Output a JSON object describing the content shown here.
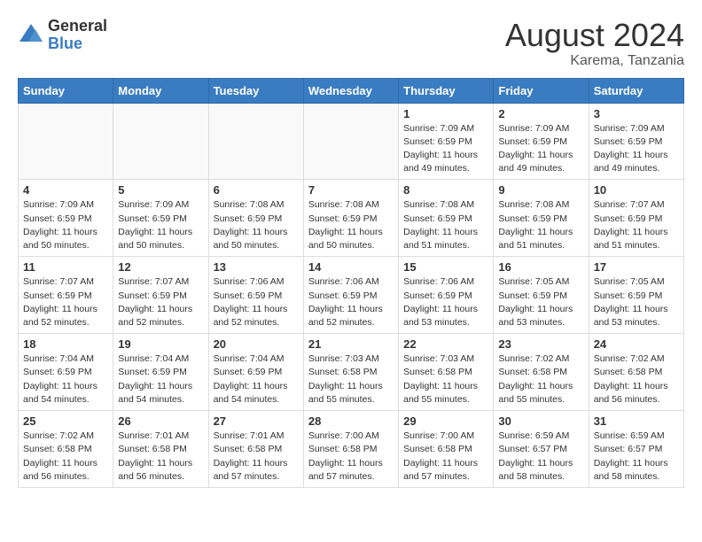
{
  "header": {
    "logo_general": "General",
    "logo_blue": "Blue",
    "month": "August 2024",
    "location": "Karema, Tanzania"
  },
  "weekdays": [
    "Sunday",
    "Monday",
    "Tuesday",
    "Wednesday",
    "Thursday",
    "Friday",
    "Saturday"
  ],
  "weeks": [
    [
      {
        "day": "",
        "info": ""
      },
      {
        "day": "",
        "info": ""
      },
      {
        "day": "",
        "info": ""
      },
      {
        "day": "",
        "info": ""
      },
      {
        "day": "1",
        "info": "Sunrise: 7:09 AM\nSunset: 6:59 PM\nDaylight: 11 hours\nand 49 minutes."
      },
      {
        "day": "2",
        "info": "Sunrise: 7:09 AM\nSunset: 6:59 PM\nDaylight: 11 hours\nand 49 minutes."
      },
      {
        "day": "3",
        "info": "Sunrise: 7:09 AM\nSunset: 6:59 PM\nDaylight: 11 hours\nand 49 minutes."
      }
    ],
    [
      {
        "day": "4",
        "info": "Sunrise: 7:09 AM\nSunset: 6:59 PM\nDaylight: 11 hours\nand 50 minutes."
      },
      {
        "day": "5",
        "info": "Sunrise: 7:09 AM\nSunset: 6:59 PM\nDaylight: 11 hours\nand 50 minutes."
      },
      {
        "day": "6",
        "info": "Sunrise: 7:08 AM\nSunset: 6:59 PM\nDaylight: 11 hours\nand 50 minutes."
      },
      {
        "day": "7",
        "info": "Sunrise: 7:08 AM\nSunset: 6:59 PM\nDaylight: 11 hours\nand 50 minutes."
      },
      {
        "day": "8",
        "info": "Sunrise: 7:08 AM\nSunset: 6:59 PM\nDaylight: 11 hours\nand 51 minutes."
      },
      {
        "day": "9",
        "info": "Sunrise: 7:08 AM\nSunset: 6:59 PM\nDaylight: 11 hours\nand 51 minutes."
      },
      {
        "day": "10",
        "info": "Sunrise: 7:07 AM\nSunset: 6:59 PM\nDaylight: 11 hours\nand 51 minutes."
      }
    ],
    [
      {
        "day": "11",
        "info": "Sunrise: 7:07 AM\nSunset: 6:59 PM\nDaylight: 11 hours\nand 52 minutes."
      },
      {
        "day": "12",
        "info": "Sunrise: 7:07 AM\nSunset: 6:59 PM\nDaylight: 11 hours\nand 52 minutes."
      },
      {
        "day": "13",
        "info": "Sunrise: 7:06 AM\nSunset: 6:59 PM\nDaylight: 11 hours\nand 52 minutes."
      },
      {
        "day": "14",
        "info": "Sunrise: 7:06 AM\nSunset: 6:59 PM\nDaylight: 11 hours\nand 52 minutes."
      },
      {
        "day": "15",
        "info": "Sunrise: 7:06 AM\nSunset: 6:59 PM\nDaylight: 11 hours\nand 53 minutes."
      },
      {
        "day": "16",
        "info": "Sunrise: 7:05 AM\nSunset: 6:59 PM\nDaylight: 11 hours\nand 53 minutes."
      },
      {
        "day": "17",
        "info": "Sunrise: 7:05 AM\nSunset: 6:59 PM\nDaylight: 11 hours\nand 53 minutes."
      }
    ],
    [
      {
        "day": "18",
        "info": "Sunrise: 7:04 AM\nSunset: 6:59 PM\nDaylight: 11 hours\nand 54 minutes."
      },
      {
        "day": "19",
        "info": "Sunrise: 7:04 AM\nSunset: 6:59 PM\nDaylight: 11 hours\nand 54 minutes."
      },
      {
        "day": "20",
        "info": "Sunrise: 7:04 AM\nSunset: 6:59 PM\nDaylight: 11 hours\nand 54 minutes."
      },
      {
        "day": "21",
        "info": "Sunrise: 7:03 AM\nSunset: 6:58 PM\nDaylight: 11 hours\nand 55 minutes."
      },
      {
        "day": "22",
        "info": "Sunrise: 7:03 AM\nSunset: 6:58 PM\nDaylight: 11 hours\nand 55 minutes."
      },
      {
        "day": "23",
        "info": "Sunrise: 7:02 AM\nSunset: 6:58 PM\nDaylight: 11 hours\nand 55 minutes."
      },
      {
        "day": "24",
        "info": "Sunrise: 7:02 AM\nSunset: 6:58 PM\nDaylight: 11 hours\nand 56 minutes."
      }
    ],
    [
      {
        "day": "25",
        "info": "Sunrise: 7:02 AM\nSunset: 6:58 PM\nDaylight: 11 hours\nand 56 minutes."
      },
      {
        "day": "26",
        "info": "Sunrise: 7:01 AM\nSunset: 6:58 PM\nDaylight: 11 hours\nand 56 minutes."
      },
      {
        "day": "27",
        "info": "Sunrise: 7:01 AM\nSunset: 6:58 PM\nDaylight: 11 hours\nand 57 minutes."
      },
      {
        "day": "28",
        "info": "Sunrise: 7:00 AM\nSunset: 6:58 PM\nDaylight: 11 hours\nand 57 minutes."
      },
      {
        "day": "29",
        "info": "Sunrise: 7:00 AM\nSunset: 6:58 PM\nDaylight: 11 hours\nand 57 minutes."
      },
      {
        "day": "30",
        "info": "Sunrise: 6:59 AM\nSunset: 6:57 PM\nDaylight: 11 hours\nand 58 minutes."
      },
      {
        "day": "31",
        "info": "Sunrise: 6:59 AM\nSunset: 6:57 PM\nDaylight: 11 hours\nand 58 minutes."
      }
    ]
  ]
}
